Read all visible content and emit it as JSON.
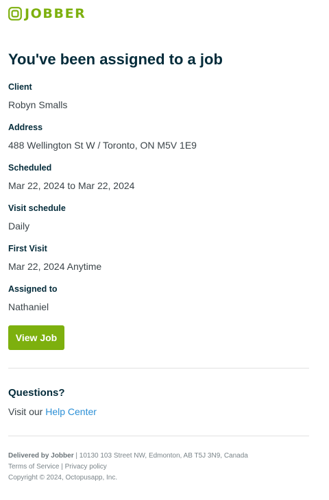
{
  "brand": {
    "name": "JOBBER",
    "color": "#7db00e"
  },
  "email": {
    "heading": "You've been assigned to a job",
    "fields": [
      {
        "label": "Client",
        "value": "Robyn Smalls"
      },
      {
        "label": "Address",
        "value": "488 Wellington St W / Toronto, ON M5V 1E9"
      },
      {
        "label": "Scheduled",
        "value": "Mar 22, 2024 to Mar 22, 2024"
      },
      {
        "label": "Visit schedule",
        "value": "Daily"
      },
      {
        "label": "First Visit",
        "value": "Mar 22, 2024 Anytime"
      },
      {
        "label": "Assigned to",
        "value": "Nathaniel"
      }
    ],
    "cta_label": "View Job"
  },
  "questions": {
    "title": "Questions?",
    "prefix": "Visit our",
    "link_text": "Help Center",
    "link_color": "#2b8fd6"
  },
  "footer": {
    "delivered_by": "Delivered by Jobber",
    "address": "10130 103 Street NW, Edmonton, AB T5J 3N9, Canada",
    "separator": "|",
    "terms": "Terms of Service",
    "privacy": "Privacy policy",
    "copyright": "Copyright © 2024, Octopusapp, Inc."
  }
}
